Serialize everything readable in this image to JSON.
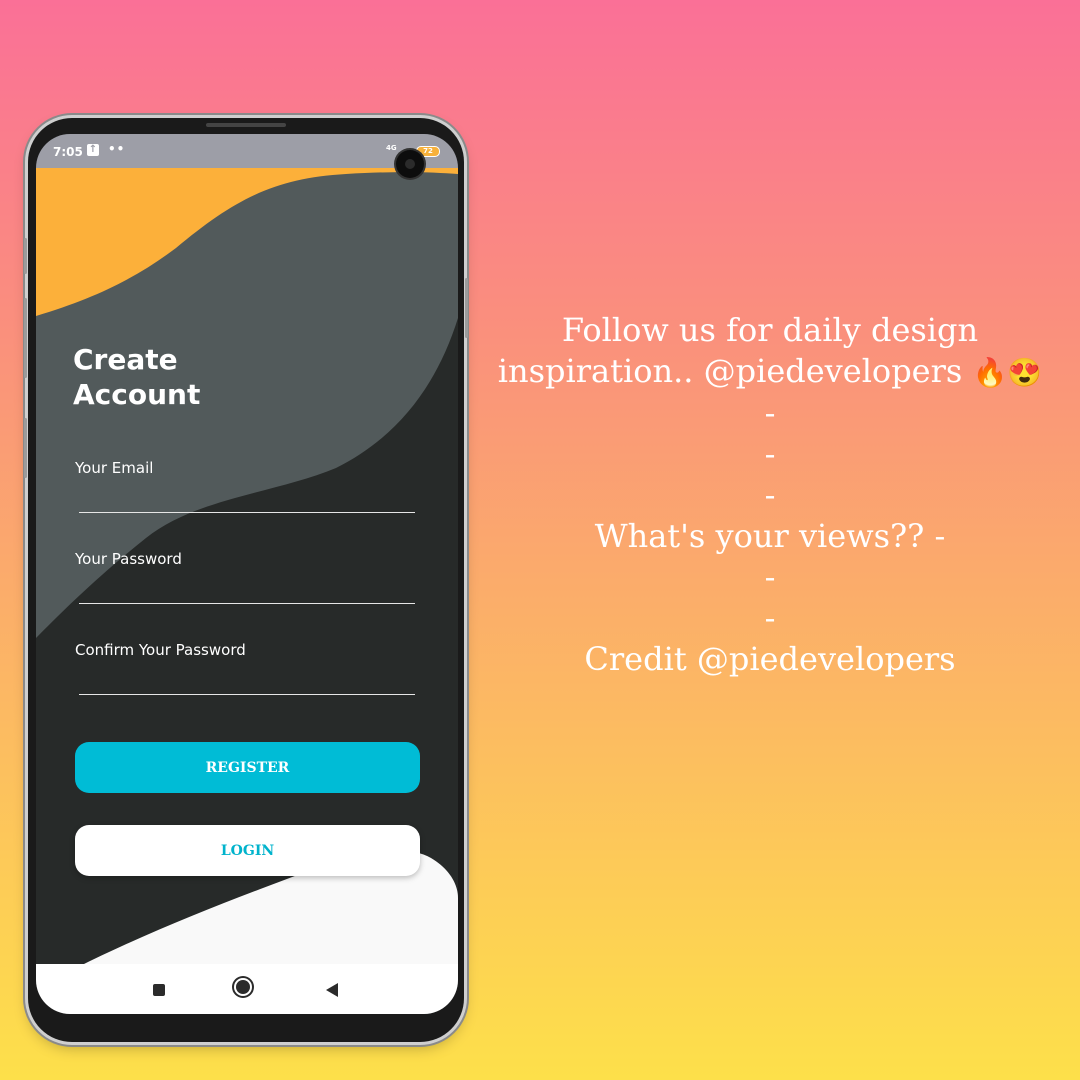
{
  "status_bar": {
    "time": "7:05",
    "upload_icon": "upload-arrow-icon",
    "dots": "••",
    "signal": "4G",
    "battery": "72"
  },
  "screen": {
    "title_line1": "Create",
    "title_line2": "Account",
    "fields": [
      {
        "label": "Your Email",
        "value": ""
      },
      {
        "label": "Your Password",
        "value": ""
      },
      {
        "label": "Confirm Your Password",
        "value": ""
      }
    ],
    "register_label": "REGISTER",
    "login_label": "LOGIN"
  },
  "colors": {
    "orange_wave": "#fcb03a",
    "gray_wave": "#525a5b",
    "dark_bg": "#272a29",
    "white_wave": "#f9f9f9",
    "register": "#00bcd6",
    "login_text": "#00b3cc"
  },
  "caption": {
    "line1": "Follow us for daily design",
    "line2": "inspiration.. @piedevelopers",
    "line2_emojis": "🔥😍",
    "dash1": "-",
    "dash2": "-",
    "dash3": "-",
    "line3": "What's your views?? -",
    "dash4": "-",
    "dash5": "-",
    "line4": "Credit @piedevelopers"
  }
}
